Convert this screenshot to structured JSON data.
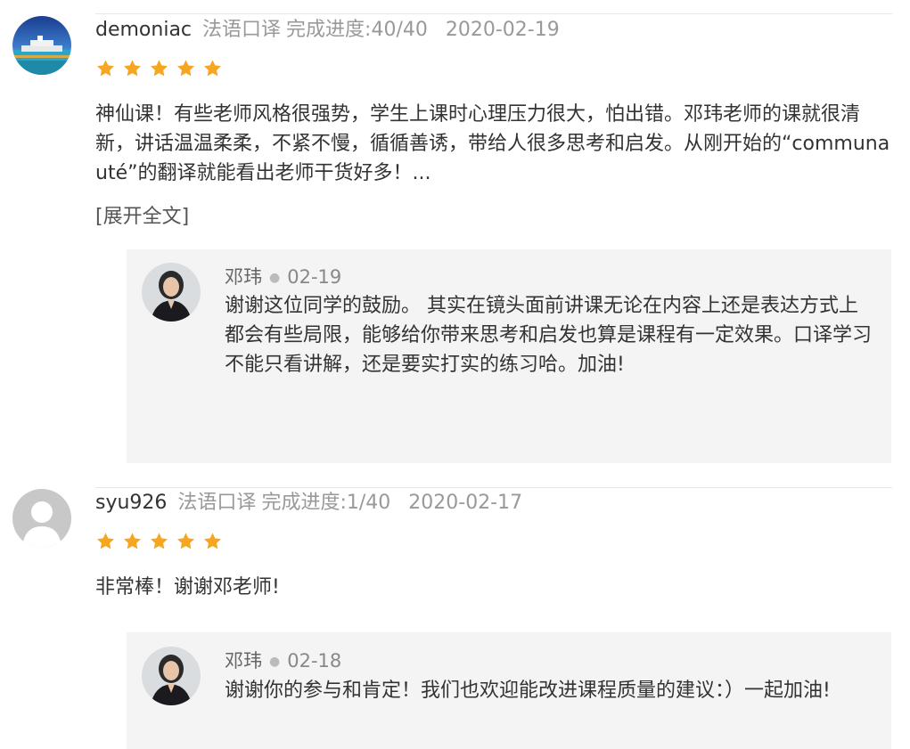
{
  "reviews": [
    {
      "user": "demoniac",
      "course": "法语口译",
      "progress": "完成进度:40/40",
      "date": "2020-02-19",
      "rating": 5,
      "content": "神仙课！有些老师风格很强势，学生上课时心理压力很大，怕出错。邓玮老师的课就很清新，讲话温温柔柔，不紧不慢，循循善诱，带给人很多思考和启发。从刚开始的“communauté”的翻译就能看出老师干货好多！...",
      "expand_label": "[展开全文]",
      "reply": {
        "user": "邓玮",
        "date": "02-19",
        "text": "谢谢这位同学的鼓励。 其实在镜头面前讲课无论在内容上还是表达方式上都会有些局限，能够给你带来思考和启发也算是课程有一定效果。口译学习不能只看讲解，还是要实打实的练习哈。加油!"
      }
    },
    {
      "user": "syu926",
      "course": "法语口译",
      "progress": "完成进度:1/40",
      "date": "2020-02-17",
      "rating": 5,
      "content": "非常棒！谢谢邓老师!",
      "reply": {
        "user": "邓玮",
        "date": "02-18",
        "text": "谢谢你的参与和肯定！我们也欢迎能改进课程质量的建议：）一起加油!"
      }
    }
  ],
  "colors": {
    "star": "#f5a623",
    "reply_bg": "#f4f4f4",
    "muted_text": "#999999"
  },
  "icons": {
    "star": "star-icon",
    "reply_separator": "dot-separator"
  }
}
